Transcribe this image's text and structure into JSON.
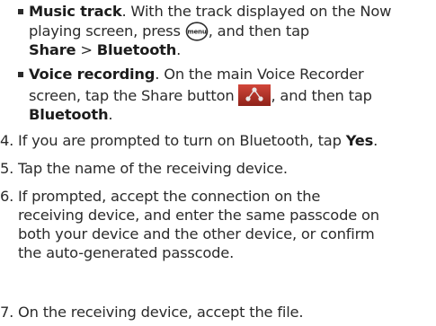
{
  "bullets": [
    {
      "lead": "Music track",
      "lines": [
        ". With the track displayed on the Now",
        "playing screen, press",
        ", and then tap"
      ],
      "key_share": "Share",
      "sep": " > ",
      "key_bt": "Bluetooth",
      "end": ".",
      "icon": "menu-key-icon",
      "menu_label": "menu"
    },
    {
      "lead": "Voice recording",
      "lines": [
        ". On the main Voice Recorder",
        "screen, tap the Share button",
        ", and then tap"
      ],
      "key_bt": "Bluetooth",
      "end": ".",
      "icon": "share-icon"
    }
  ],
  "steps": [
    {
      "num": "4.",
      "pre": "If you are prompted to turn on Bluetooth, tap ",
      "key": "Yes",
      "post": "."
    },
    {
      "num": "5.",
      "lines": [
        "Tap the name of the receiving device."
      ]
    },
    {
      "num": "6.",
      "lines": [
        "If prompted, accept the connection on the",
        "receiving device, and enter the same passcode on",
        "both your device and the other device, or confirm",
        "the auto-generated passcode."
      ]
    },
    {
      "num": "7.",
      "lines": [
        "On the receiving device, accept the file."
      ]
    }
  ],
  "colors": {
    "text": "#2b2b2b",
    "share_icon_bg": "#b9332a"
  }
}
